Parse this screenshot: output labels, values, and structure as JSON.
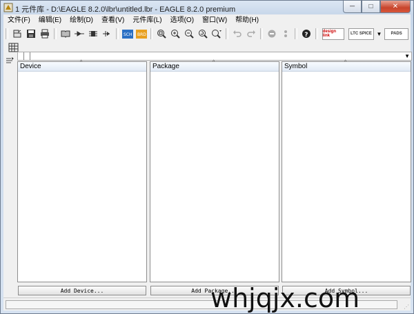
{
  "window": {
    "title": "1 元件库 - D:\\EAGLE 8.2.0\\lbr\\untitled.lbr - EAGLE 8.2.0 premium",
    "minimize_label": "─",
    "maximize_label": "□",
    "close_label": "✕"
  },
  "menubar": {
    "items": [
      {
        "label": "文件(F)"
      },
      {
        "label": "编辑(E)"
      },
      {
        "label": "绘制(D)"
      },
      {
        "label": "查看(V)"
      },
      {
        "label": "元件库(L)"
      },
      {
        "label": "选项(O)"
      },
      {
        "label": "窗口(W)"
      },
      {
        "label": "帮助(H)"
      }
    ]
  },
  "toolbar": {
    "icons": [
      "open-icon",
      "save-icon",
      "print-icon",
      "book-icon",
      "device-icon",
      "package-icon",
      "symbol-icon",
      "sch-icon",
      "brd-icon",
      "zoom-fit-icon",
      "zoom-in-icon",
      "zoom-out-icon",
      "zoom-redraw-icon",
      "zoom-select-icon",
      "undo-icon",
      "redo-icon",
      "stop-icon",
      "go-icon",
      "help-icon"
    ],
    "logos": {
      "design_link": "design link",
      "ltspice": "LTC SPICE",
      "pads": "PADS"
    }
  },
  "panels": {
    "device": {
      "header": "Device",
      "button": "Add Device..."
    },
    "package": {
      "header": "Package",
      "button": "Add Package..."
    },
    "symbol": {
      "header": "Symbol",
      "button": "Add Symbol..."
    }
  },
  "watermark": {
    "text": "whjqjx.com"
  },
  "colors": {
    "accent": "#c8d7ea",
    "panel_header": "#e1eaf5",
    "close_button": "#c8452c"
  }
}
